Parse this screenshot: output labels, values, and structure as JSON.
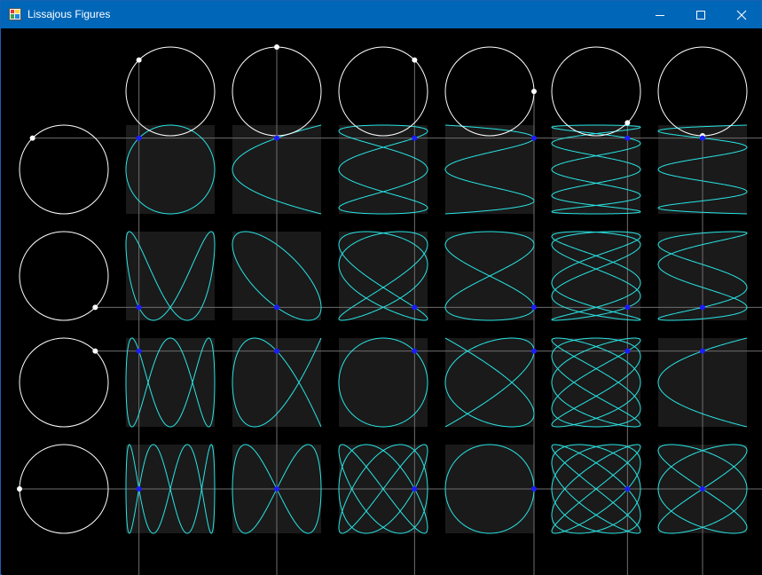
{
  "window": {
    "title": "Lissajous Figures",
    "titlebar_color": "#0066b8",
    "buttons": {
      "minimize_icon": "minimize-icon",
      "maximize_icon": "maximize-icon",
      "close_icon": "close-icon"
    }
  },
  "colors": {
    "background": "#000000",
    "circle": "#ffffff",
    "curve": "#29e5e5",
    "cell_background": "#1a1a1a",
    "guide_line": "#6e6e6e",
    "marker": "#1c1cff"
  },
  "figure": {
    "column_frequencies": [
      1,
      2,
      3,
      4,
      5,
      6
    ],
    "row_frequencies": [
      1,
      2,
      3,
      4
    ],
    "column_phase_angles_deg": [
      -135,
      -90,
      -45,
      0,
      45,
      90
    ],
    "row_phase_angles_deg": [
      -135,
      45,
      -45,
      180
    ]
  }
}
